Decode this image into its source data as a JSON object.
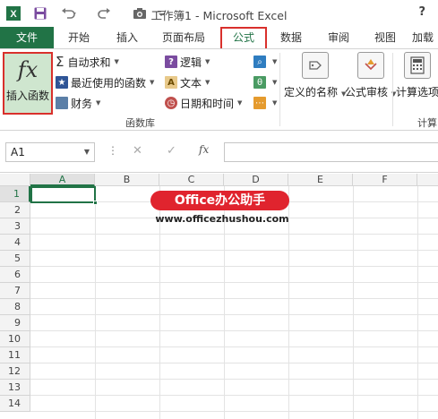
{
  "window": {
    "title": "工作簿1 - Microsoft Excel",
    "help": "?"
  },
  "quick_access": {
    "app_icon": "excel-icon",
    "save_icon": "save-icon",
    "undo_icon": "undo-icon",
    "redo_icon": "redo-icon",
    "camera_icon": "camera-icon",
    "customize_icon": "chevron-down-icon"
  },
  "tabs": [
    {
      "label": "文件"
    },
    {
      "label": "开始"
    },
    {
      "label": "插入"
    },
    {
      "label": "页面布局"
    },
    {
      "label": "公式"
    },
    {
      "label": "数据"
    },
    {
      "label": "审阅"
    },
    {
      "label": "视图"
    },
    {
      "label": "加载"
    }
  ],
  "ribbon": {
    "insert_function": {
      "icon_text": "fx",
      "label": "插入函数"
    },
    "autosum": "自动求和",
    "recent": "最近使用的函数",
    "financial": "财务",
    "logical": "逻辑",
    "text": "文本",
    "datetime": "日期和时间",
    "group_library": "函数库",
    "define_name": "定义的名称",
    "formula_audit": "公式审核",
    "calc_options": "计算选项",
    "group_calc": "计算",
    "sigma": "Σ",
    "logical_icon": "?",
    "text_icon": "A"
  },
  "formula_bar": {
    "name_box": "A1",
    "dots": "⋮",
    "cancel": "✕",
    "enter": "✓",
    "fx": "fx",
    "value": ""
  },
  "sheet": {
    "columns": [
      "A",
      "B",
      "C",
      "D",
      "E",
      "F"
    ],
    "rows": [
      "1",
      "2",
      "3",
      "4",
      "5",
      "6",
      "7",
      "8",
      "9",
      "10",
      "11",
      "12",
      "13",
      "14"
    ],
    "active_cell": "A1"
  },
  "watermark": {
    "brand": "Office办公助手",
    "url": "www.officezhushou.com"
  },
  "colors": {
    "excel_green": "#217346",
    "highlight_red": "#d9302c",
    "watermark_red": "#e0242e"
  }
}
